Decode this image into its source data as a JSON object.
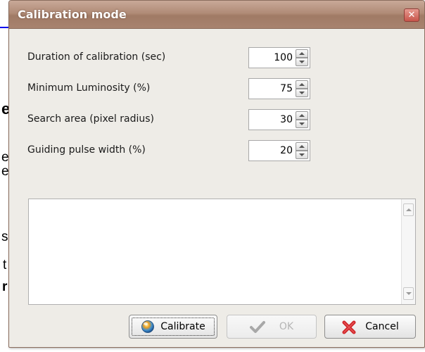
{
  "background": {
    "fragments": [
      "e",
      "e",
      "e",
      "s",
      "t",
      "r"
    ]
  },
  "dialog": {
    "title": "Calibration mode",
    "close_glyph": "✕",
    "rows": [
      {
        "label": "Duration of calibration (sec)",
        "value": "100"
      },
      {
        "label": "Minimum Luminosity (%)",
        "value": "75"
      },
      {
        "label": "Search area (pixel radius)",
        "value": "30"
      },
      {
        "label": "Guiding pulse width (%)",
        "value": "20"
      }
    ],
    "log_text": "",
    "buttons": {
      "calibrate": "Calibrate",
      "ok": "OK",
      "cancel": "Cancel"
    },
    "icons": {
      "calibrate": "sphere-icon",
      "ok": "checkmark-icon",
      "cancel": "red-x-icon",
      "close": "close-icon"
    },
    "colors": {
      "titlebar": "#b08b77",
      "close_button": "#c7554b",
      "body": "#eeece7",
      "cancel_x": "#d0262a",
      "ok_check": "#a8a8a8"
    }
  }
}
